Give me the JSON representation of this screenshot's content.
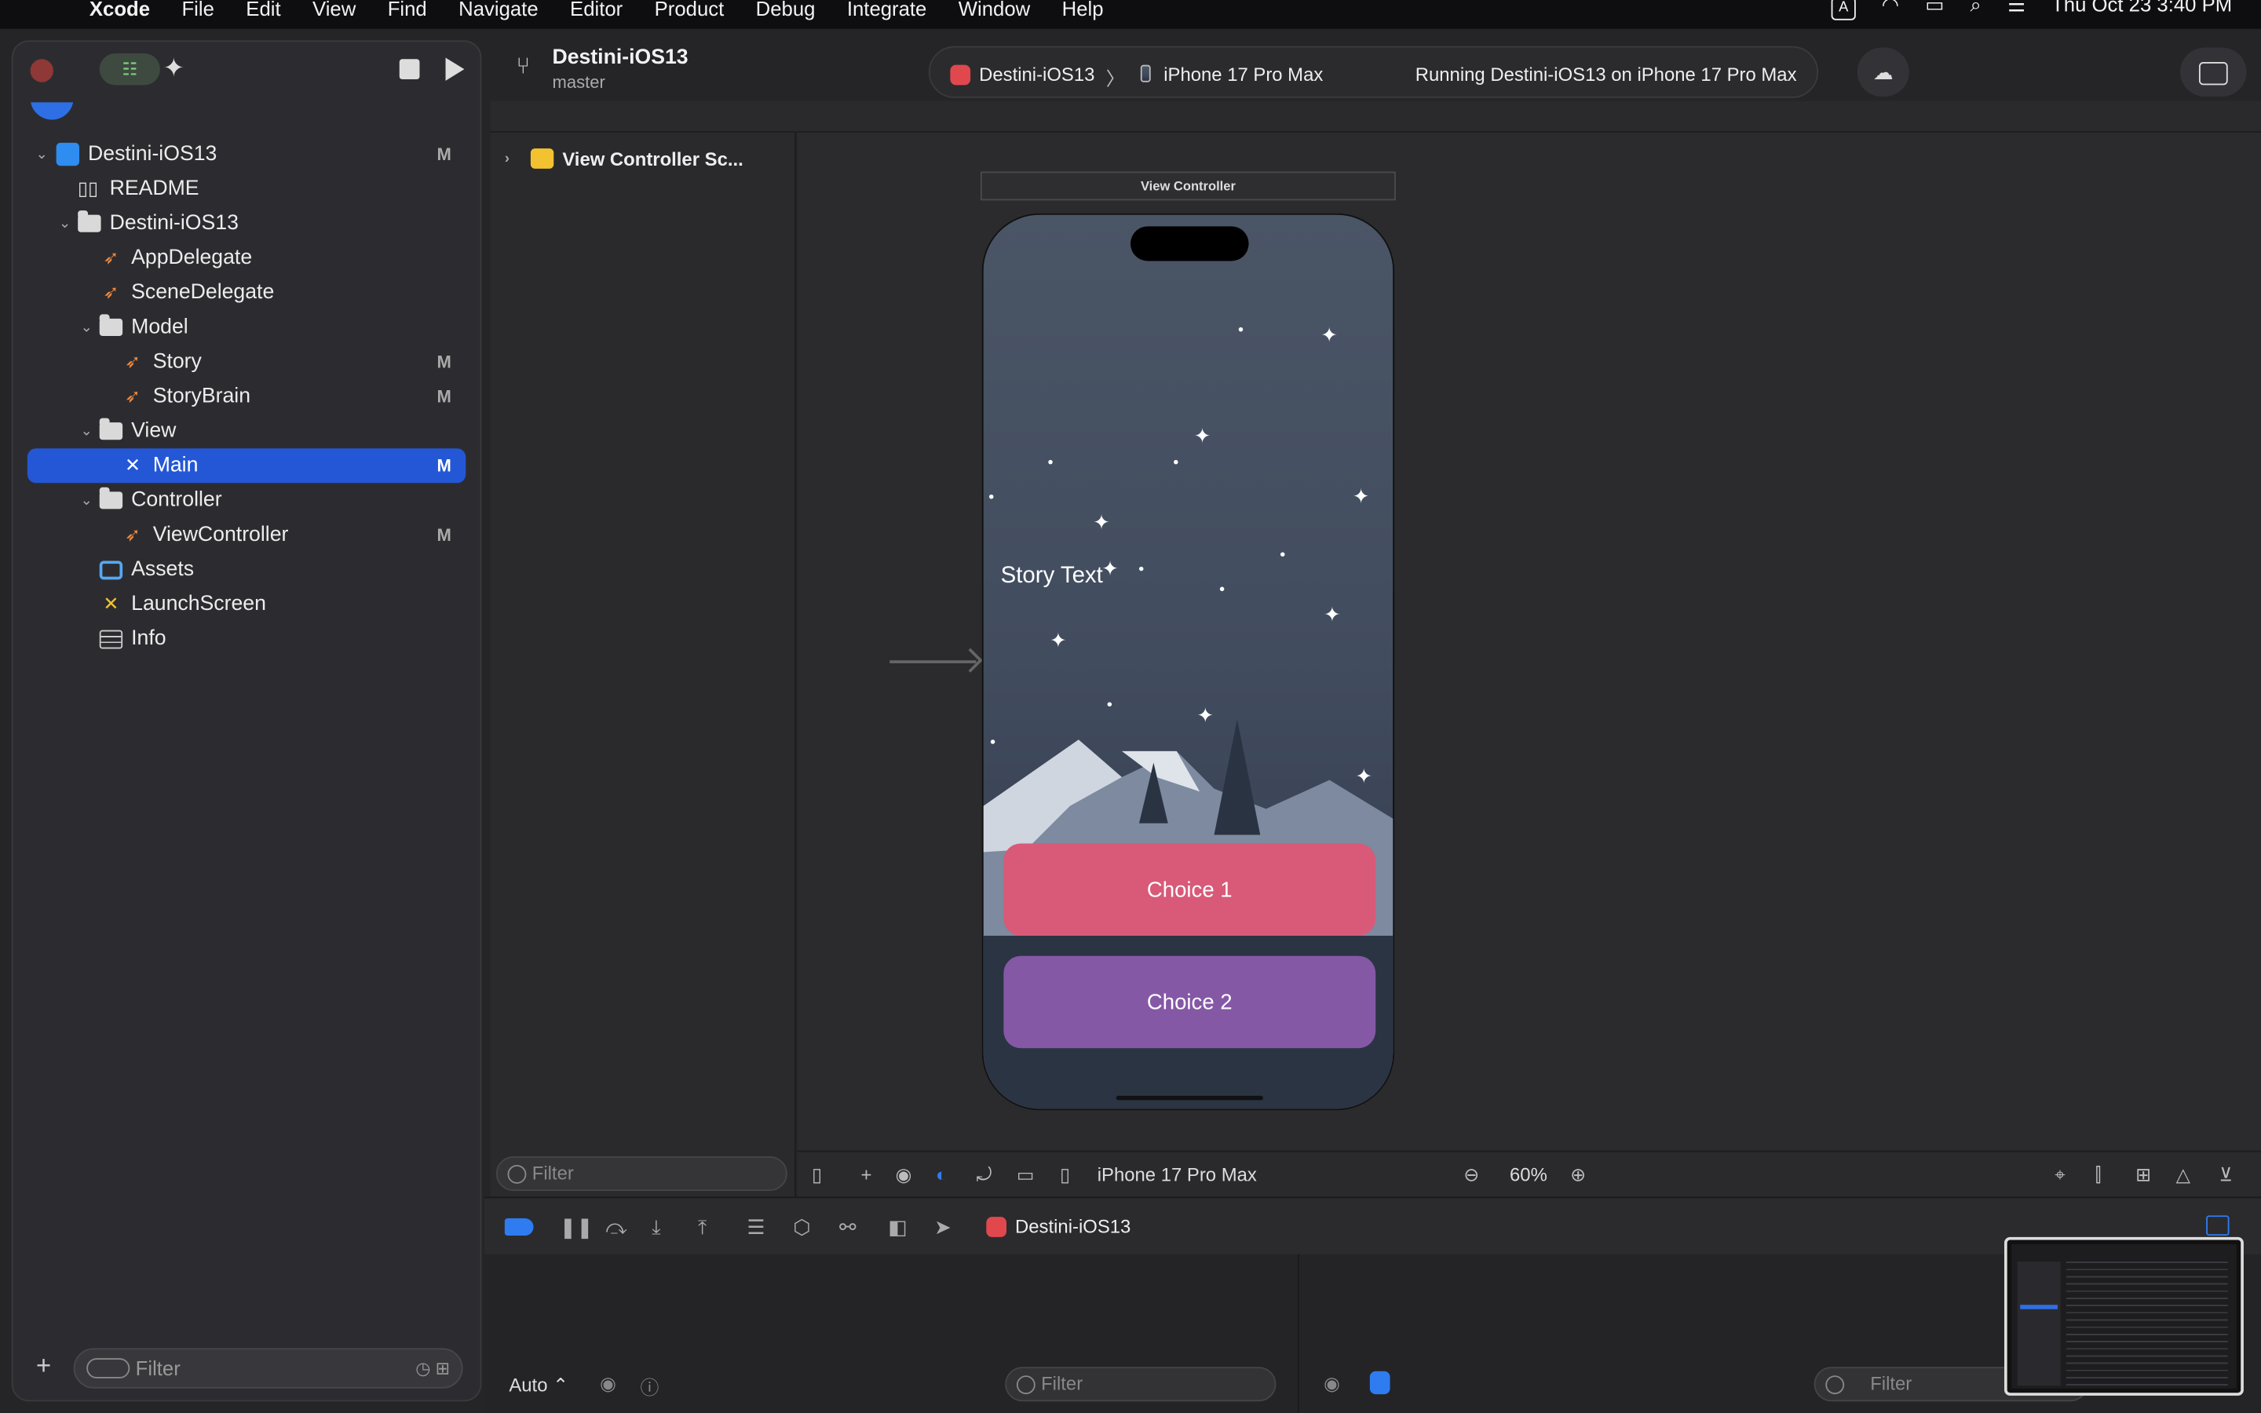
{
  "menubar": {
    "app": "Xcode",
    "items": [
      "File",
      "Edit",
      "View",
      "Find",
      "Navigate",
      "Editor",
      "Product",
      "Debug",
      "Integrate",
      "Window",
      "Help"
    ],
    "input_source": "A",
    "clock": "Thu Oct 23  3:40 PM"
  },
  "toolbar": {
    "project": "Destini-iOS13",
    "branch": "master",
    "scheme": "Destini-iOS13",
    "scheme_sep": "〉",
    "device": "iPhone 17 Pro Max",
    "status": "Running Destini-iOS13 on iPhone 17 Pro Max"
  },
  "navigator": {
    "items": [
      {
        "label": "Destini-iOS13",
        "badge": "M"
      },
      {
        "label": "README",
        "badge": ""
      },
      {
        "label": "Destini-iOS13",
        "badge": ""
      },
      {
        "label": "AppDelegate",
        "badge": ""
      },
      {
        "label": "SceneDelegate",
        "badge": ""
      },
      {
        "label": "Model",
        "badge": ""
      },
      {
        "label": "Story",
        "badge": "M"
      },
      {
        "label": "StoryBrain",
        "badge": "M"
      },
      {
        "label": "View",
        "badge": ""
      },
      {
        "label": "Main",
        "badge": "M"
      },
      {
        "label": "Controller",
        "badge": ""
      },
      {
        "label": "ViewController",
        "badge": "M"
      },
      {
        "label": "Assets",
        "badge": ""
      },
      {
        "label": "LaunchScreen",
        "badge": ""
      },
      {
        "label": "Info",
        "badge": ""
      }
    ],
    "filter_placeholder": "Filter"
  },
  "outline": {
    "item": "View Controller Sc...",
    "filter_placeholder": "Filter"
  },
  "canvas": {
    "scene_title": "View Controller",
    "story_text": "Story Text",
    "choice1": "Choice 1",
    "choice2": "Choice 2",
    "device": "iPhone 17 Pro Max",
    "zoom": "60%"
  },
  "debug": {
    "target": "Destini-iOS13"
  },
  "console": {
    "mode": "Auto ⌃",
    "filter_left": "Filter",
    "filter_right": "Filter"
  },
  "colors": {
    "selection": "#2457d6",
    "choice1": "#d85a78",
    "choice2": "#8558a6",
    "accent": "#2f7cf0"
  }
}
